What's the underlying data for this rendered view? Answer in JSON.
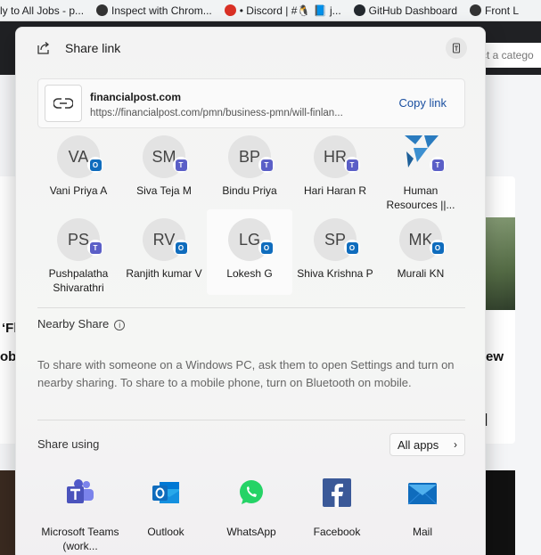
{
  "bookmarks": [
    {
      "label": "ly to All Jobs - p..."
    },
    {
      "label": "Inspect with Chrom..."
    },
    {
      "label": "• Discord | #🐧 📘 j..."
    },
    {
      "label": "GitHub Dashboard"
    },
    {
      "label": "Front L"
    }
  ],
  "background": {
    "search_placeholder": "ct a catego",
    "frag1": "‘Fl",
    "frag2": "ob",
    "frag3": "ew",
    "frag4": "]"
  },
  "dialog": {
    "title": "Share link",
    "link": {
      "domain": "financialpost.com",
      "url": "https://financialpost.com/pmn/business-pmn/will-finlan...",
      "copy_label": "Copy link"
    },
    "contacts": [
      {
        "initials": "VA",
        "name": "Vani Priya A",
        "app": "outlook"
      },
      {
        "initials": "SM",
        "name": "Siva Teja M",
        "app": "teams"
      },
      {
        "initials": "BP",
        "name": "Bindu Priya",
        "app": "teams"
      },
      {
        "initials": "HR",
        "name": "Hari Haran R",
        "app": "teams"
      },
      {
        "initials": "",
        "name": "Human Resources ||...",
        "app": "teams"
      },
      {
        "initials": "PS",
        "name": "Pushpalatha Shivarathri",
        "app": "teams"
      },
      {
        "initials": "RV",
        "name": "Ranjith kumar V",
        "app": "outlook"
      },
      {
        "initials": "LG",
        "name": "Lokesh G",
        "app": "outlook"
      },
      {
        "initials": "SP",
        "name": "Shiva Krishna P",
        "app": "outlook"
      },
      {
        "initials": "MK",
        "name": "Murali KN",
        "app": "outlook"
      }
    ],
    "nearby": {
      "title": "Nearby Share",
      "text": "To share with someone on a Windows PC, ask them to open Settings and turn on nearby sharing. To share to a mobile phone, turn on Bluetooth on mobile."
    },
    "share_using": {
      "title": "Share using",
      "all_apps": "All apps",
      "apps": [
        {
          "name": "Microsoft Teams (work...",
          "icon": "teams-icon"
        },
        {
          "name": "Outlook",
          "icon": "outlook-icon"
        },
        {
          "name": "WhatsApp",
          "icon": "whatsapp-icon"
        },
        {
          "name": "Facebook",
          "icon": "facebook-icon"
        },
        {
          "name": "Mail",
          "icon": "mail-icon"
        }
      ]
    }
  }
}
